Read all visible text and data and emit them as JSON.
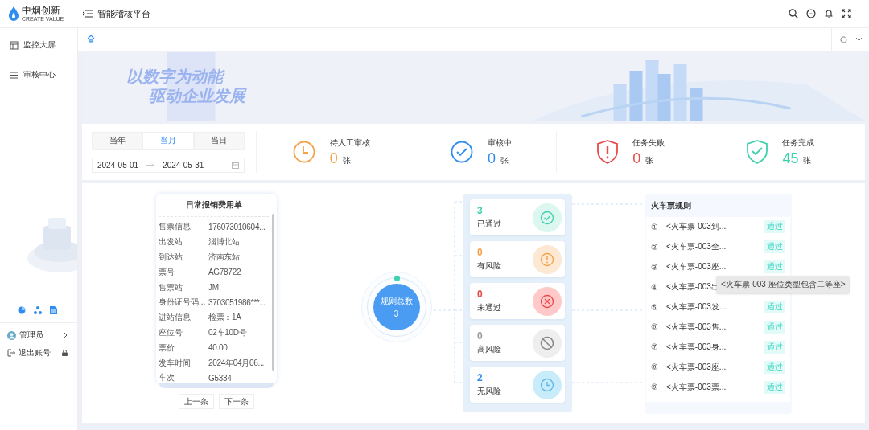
{
  "logo": {
    "name": "中烟创新",
    "tagline": "CREATE VALUE"
  },
  "header": {
    "title": "智能稽核平台"
  },
  "sidebar": {
    "items": [
      {
        "label": "监控大屏",
        "selected": false
      },
      {
        "label": "审核中心",
        "selected": false
      }
    ],
    "user": {
      "name": "管理员"
    },
    "logout": {
      "label": "退出账号"
    }
  },
  "tabs": [
    {
      "selected": true
    }
  ],
  "banner": {
    "line_1": "以数字为动能",
    "line_2": "驱动企业发展"
  },
  "period": {
    "options": [
      {
        "label": "当年",
        "selected": false
      },
      {
        "label": "当月",
        "selected": true
      },
      {
        "label": "当日",
        "selected": false
      }
    ],
    "start": "2024-05-01",
    "end": "2024-05-31"
  },
  "stats": [
    {
      "kind": "clock",
      "label": "待人工审核",
      "value": "0",
      "unit": "张",
      "color": "#f5a24b"
    },
    {
      "kind": "check",
      "label": "审核中",
      "value": "0",
      "unit": "张",
      "color": "#2f8cf0"
    },
    {
      "kind": "alert",
      "label": "任务失败",
      "value": "0",
      "unit": "张",
      "color": "#e84a4a"
    },
    {
      "kind": "done",
      "label": "任务完成",
      "value": "45",
      "unit": "张",
      "color": "#3fd0ae"
    }
  ],
  "document": {
    "title": "日常报销费用单",
    "fields": [
      {
        "label": "售票信息",
        "value": "176073010604..."
      },
      {
        "label": "出发站",
        "value": "淄博北站"
      },
      {
        "label": "到达站",
        "value": "济南东站"
      },
      {
        "label": "票号",
        "value": "AG78722"
      },
      {
        "label": "售票站",
        "value": "JM"
      },
      {
        "label": "身份证号码...",
        "value": "3703051986***..."
      },
      {
        "label": "进站信息",
        "value": "检票：1A"
      },
      {
        "label": "座位号",
        "value": "02车10D号"
      },
      {
        "label": "票价",
        "value": "40.00"
      },
      {
        "label": "发车时间",
        "value": "2024年04月06..."
      },
      {
        "label": "车次",
        "value": "G5334"
      }
    ],
    "prev": "上一条",
    "next": "下一条"
  },
  "total": {
    "label": "规则总数",
    "value": "3"
  },
  "results": [
    {
      "kind": "pass",
      "value": "3",
      "label": "已通过"
    },
    {
      "kind": "risk",
      "value": "0",
      "label": "有风险"
    },
    {
      "kind": "fail",
      "value": "0",
      "label": "未通过"
    },
    {
      "kind": "high",
      "value": "0",
      "label": "高风险"
    },
    {
      "kind": "none",
      "value": "2",
      "label": "无风险"
    }
  ],
  "rules": {
    "title": "火车票规则",
    "items": [
      {
        "num": "①",
        "text": "<火车票-003到...",
        "status": "通过"
      },
      {
        "num": "②",
        "text": "<火车票-003全...",
        "status": "通过"
      },
      {
        "num": "③",
        "text": "<火车票-003座...",
        "status": "通过"
      },
      {
        "num": "④",
        "text": "<火车票-003出"
      },
      {
        "num": "⑤",
        "text": "<火车票-003发...",
        "status": "通过"
      },
      {
        "num": "⑥",
        "text": "<火车票-003售...",
        "status": "通过"
      },
      {
        "num": "⑦",
        "text": "<火车票-003身...",
        "status": "通过"
      },
      {
        "num": "⑧",
        "text": "<火车票-003座...",
        "status": "通过"
      },
      {
        "num": "⑨",
        "text": "<火车票-003票...",
        "status": "通过"
      }
    ],
    "tooltip": "<火车票-003 座位类型包含二等座>"
  }
}
